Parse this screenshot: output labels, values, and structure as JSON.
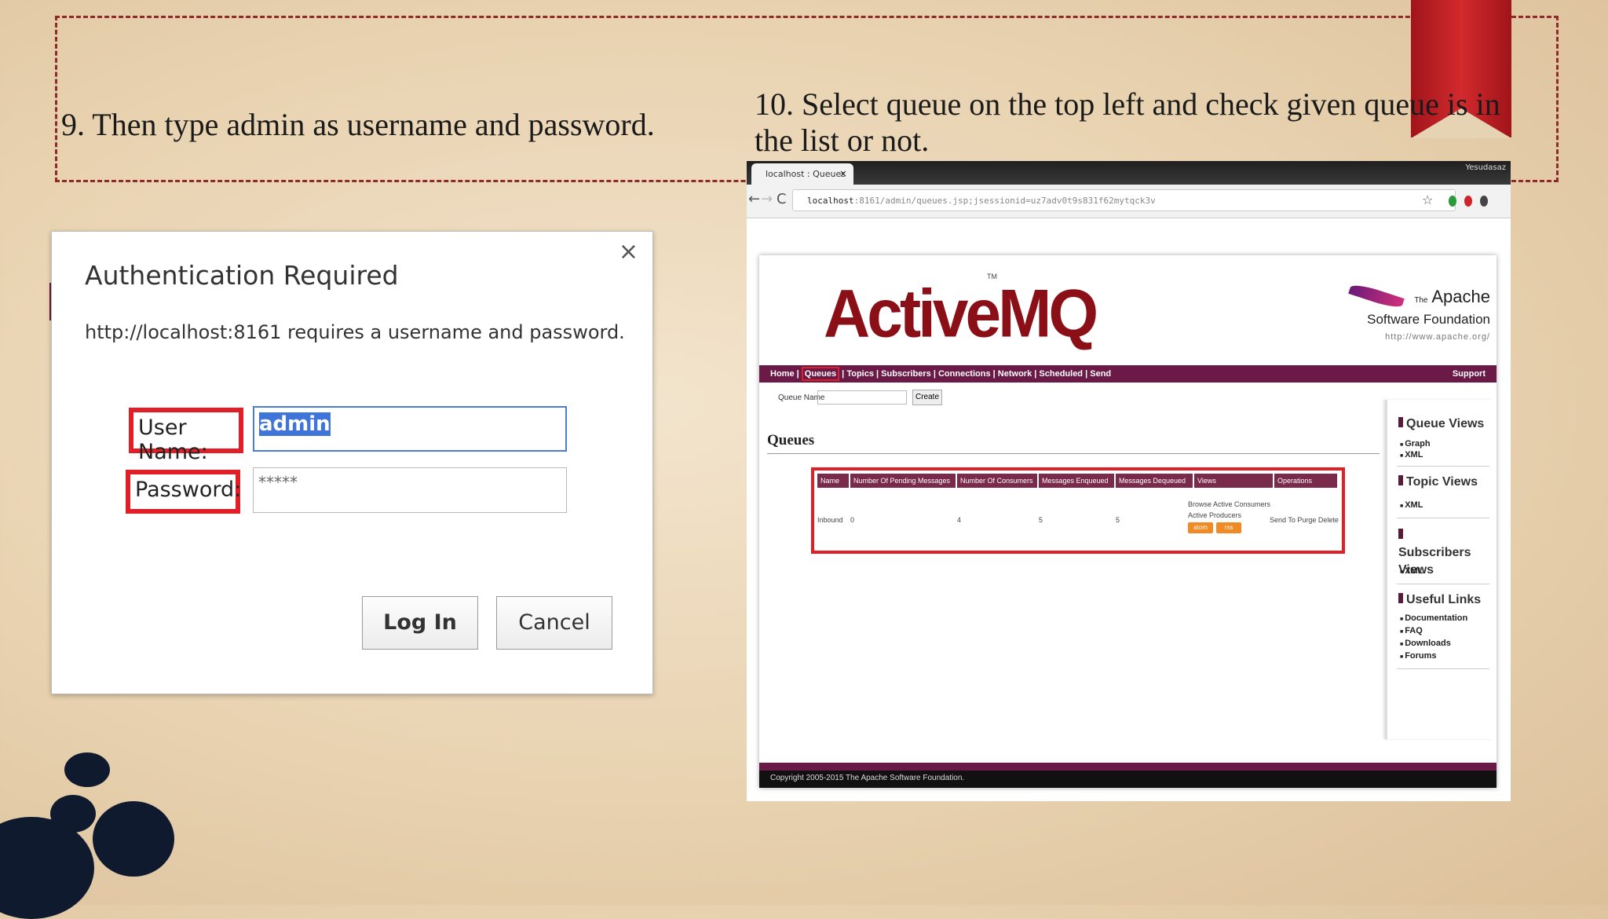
{
  "slide": {
    "step9": "9. Then type admin as username and password.",
    "step10": "10. Select queue on the top left and check given queue is in the list or not."
  },
  "dialog": {
    "title": "Authentication Required",
    "message": "http://localhost:8161 requires a username and password.",
    "username_label": "User Name:",
    "username_value": "admin",
    "password_label": "Password:",
    "password_value": "*****",
    "login_label": "Log In",
    "cancel_label": "Cancel",
    "close_glyph": "×"
  },
  "browser": {
    "tab_title": "localhost : Queues",
    "tab_close": "×",
    "window_user": "Yesudasaz",
    "address_host": "localhost",
    "address_path": ":8161/admin/queues.jsp;jsessionid=uz7adv0t9s831f62mytqck3v",
    "back": "←",
    "forward": "→",
    "reload": "C",
    "star": "☆"
  },
  "activemq": {
    "logo": "ActiveMQ",
    "tm": "TM",
    "asf_the": "The",
    "asf_name1": "Apache",
    "asf_name2": "Software Foundation",
    "asf_url": "http://www.apache.org/",
    "menu": [
      "Home",
      "Queues",
      "Topics",
      "Subscribers",
      "Connections",
      "Network",
      "Scheduled",
      "Send"
    ],
    "menu_support": "Support",
    "queue_name_label": "Queue Name",
    "create_label": "Create",
    "queues_heading": "Queues",
    "table": {
      "headers": [
        "Name",
        "Number Of Pending Messages",
        "Number Of Consumers",
        "Messages Enqueued",
        "Messages Dequeued",
        "Views",
        "Operations"
      ],
      "row": {
        "name": "Inbound",
        "pending": "0",
        "consumers": "4",
        "enqueued": "5",
        "dequeued": "5",
        "views_line1": "Browse Active Consumers",
        "views_line2": "Active Producers",
        "rss1": "atom",
        "rss2": "rss",
        "operations": "Send To Purge Delete"
      }
    },
    "sidebar": {
      "queue_views": "Queue Views",
      "queue_items": [
        "Graph",
        "XML"
      ],
      "topic_views": "Topic Views",
      "topic_items": [
        "XML"
      ],
      "subscribers_views": "Subscribers Views",
      "subscribers_items": [
        "XML"
      ],
      "useful_links": "Useful Links",
      "useful_items": [
        "Documentation",
        "FAQ",
        "Downloads",
        "Forums"
      ]
    },
    "footer": "Copyright 2005-2015 The Apache Software Foundation."
  }
}
